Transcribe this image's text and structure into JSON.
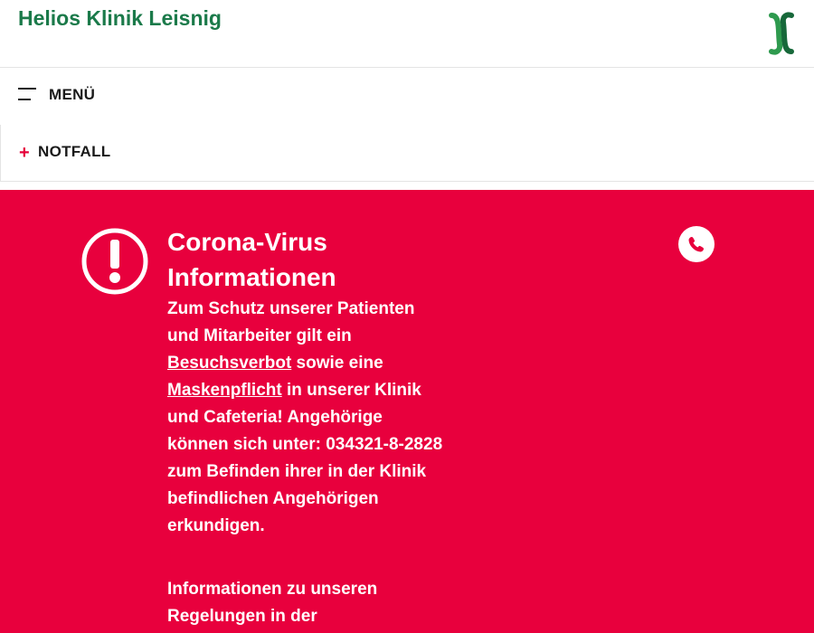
{
  "header": {
    "site_title": "Helios Klinik Leisnig",
    "logo_icon": "helios-logo-icon"
  },
  "menu": {
    "label": "MENÜ",
    "icon": "hamburger-icon"
  },
  "notfall": {
    "label": "NOTFALL",
    "icon": "plus-icon"
  },
  "alert": {
    "background_color": "#e8003d",
    "title": "Corona-Virus Informationen",
    "icon": "exclamation-circle-icon",
    "phone_icon": "phone-icon",
    "body_part1": "Zum Schutz unserer Patienten und Mitarbeiter gilt ein ",
    "link_besuchsverbot": "Besuchsverbot",
    "body_part2": " sowie eine ",
    "link_maskenpflicht": "Maskenpflicht",
    "body_part3": " in unserer Klinik und Cafeteria! Angehörige können sich unter: 034321-8-2828 zum Befinden ihrer in der Klinik befindlichen Angehörigen erkundigen.",
    "more_info": "Informationen zu unseren Regelungen in der"
  },
  "colors": {
    "brand_green": "#1b7a4a",
    "accent_red": "#e5003a"
  }
}
